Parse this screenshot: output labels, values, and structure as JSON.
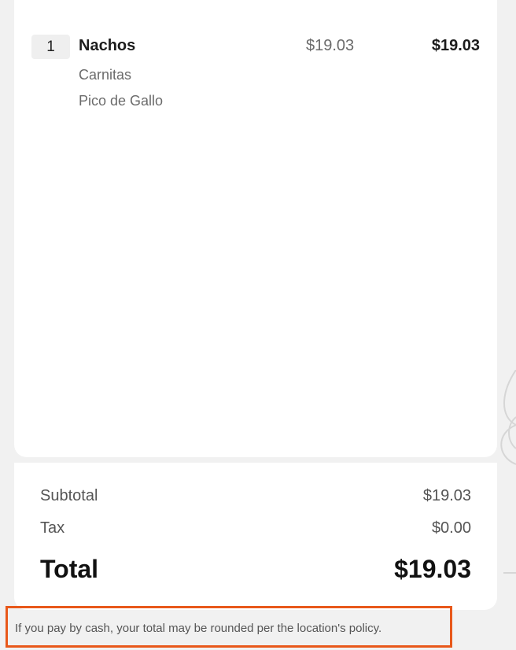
{
  "order": {
    "items": [
      {
        "quantity": "1",
        "name": "Nachos",
        "unit_price": "$19.03",
        "total": "$19.03",
        "modifiers": [
          "Carnitas",
          "Pico de Gallo"
        ]
      }
    ]
  },
  "totals": {
    "subtotal_label": "Subtotal",
    "subtotal_value": "$19.03",
    "tax_label": "Tax",
    "tax_value": "$0.00",
    "total_label": "Total",
    "total_value": "$19.03"
  },
  "notice": {
    "cash_rounding": "If you pay by cash, your total may be rounded per the location's policy."
  },
  "colors": {
    "background": "#f1f1f1",
    "card": "#ffffff",
    "notice_border": "#e8581a"
  }
}
